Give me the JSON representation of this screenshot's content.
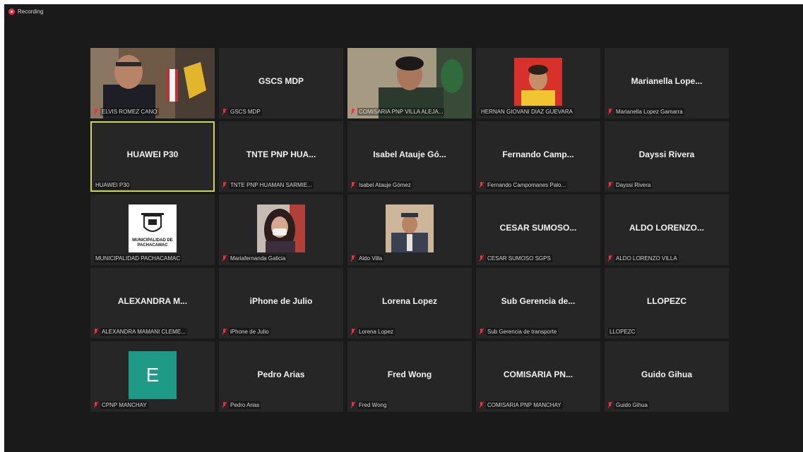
{
  "recording_label": "Recording",
  "colors": {
    "window_bg": "#1a1a1a",
    "tile_bg": "#262626",
    "active_border": "#c9d952",
    "muted_red": "#e0383e",
    "avatar_teal": "#1f9a87"
  },
  "tiles": [
    {
      "name": "",
      "label": "ELVIS ROMEZ CANO",
      "muted": true,
      "media": "video"
    },
    {
      "name": "GSCS MDP",
      "label": "GSCS MDP",
      "muted": true
    },
    {
      "name": "",
      "label": "COMISARIA PNP VILLA ALEJA...",
      "muted": true,
      "media": "video"
    },
    {
      "name": "",
      "label": "HERNAN GIOVANI DIAZ GUEVARA",
      "muted": false,
      "media": "photo"
    },
    {
      "name": "Marianella Lope...",
      "label": "Marianella Lopez Gamarra",
      "muted": true
    },
    {
      "name": "HUAWEI P30",
      "label": "HUAWEI P30",
      "muted": false,
      "active": true
    },
    {
      "name": "TNTE PNP HUA...",
      "label": "TNTE PNP HUAMAN SARMIE...",
      "muted": true
    },
    {
      "name": "Isabel Atauje Gó...",
      "label": "Isabel Atauje Gómez",
      "muted": true
    },
    {
      "name": "Fernando Camp...",
      "label": "Fernando Campomanes Palo...",
      "muted": true
    },
    {
      "name": "Dayssi Rivera",
      "label": "Dayssi Rivera",
      "muted": true
    },
    {
      "name": "",
      "label": "MUNICIPALIDAD PACHACAMAC",
      "muted": false,
      "media": "logo",
      "logo_text": "MUNICIPALIDAD DE PACHACAMAC"
    },
    {
      "name": "",
      "label": "Mariafernanda Galicia",
      "muted": true,
      "media": "photo"
    },
    {
      "name": "",
      "label": "Aldo Villa",
      "muted": true,
      "media": "photo"
    },
    {
      "name": "CESAR SUMOSO...",
      "label": "CESAR SUMOSO SGPS",
      "muted": true
    },
    {
      "name": "ALDO LORENZO...",
      "label": "ALDO LORENZO VILLA",
      "muted": true
    },
    {
      "name": "ALEXANDRA M...",
      "label": "ALEXANDRA MAMANI CLEME...",
      "muted": true
    },
    {
      "name": "iPhone de Julio",
      "label": "iPhone de Julio",
      "muted": true
    },
    {
      "name": "Lorena Lopez",
      "label": "Lorena Lopez",
      "muted": true
    },
    {
      "name": "Sub Gerencia de...",
      "label": "Sub Gerencia de transporte",
      "muted": true
    },
    {
      "name": "LLOPEZC",
      "label": "LLOPEZC",
      "muted": false
    },
    {
      "name": "",
      "label": "CPNP MANCHAY",
      "muted": true,
      "media": "letter",
      "avatar_letter": "E"
    },
    {
      "name": "Pedro Arias",
      "label": "Pedro Arias",
      "muted": true
    },
    {
      "name": "Fred Wong",
      "label": "Fred Wong",
      "muted": true
    },
    {
      "name": "COMISARIA PN...",
      "label": "COMISARIA PNP MANCHAY",
      "muted": true
    },
    {
      "name": "Guido Gihua",
      "label": "Guido Gihua",
      "muted": true
    }
  ]
}
